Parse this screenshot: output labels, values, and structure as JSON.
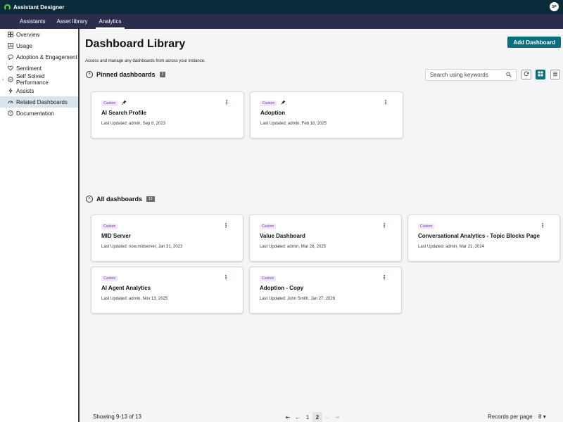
{
  "app": {
    "title": "Assistant Designer",
    "avatar_initials": "SP"
  },
  "tabs": [
    {
      "label": "Assistants"
    },
    {
      "label": "Asset library"
    },
    {
      "label": "Analytics",
      "active": true
    }
  ],
  "sidebar": {
    "items": [
      {
        "label": "Overview",
        "icon": "grid-icon"
      },
      {
        "label": "Usage",
        "icon": "chart-icon"
      },
      {
        "label": "Adoption & Engagement",
        "icon": "chat-icon"
      },
      {
        "label": "Sentiment",
        "icon": "heart-icon"
      },
      {
        "label": "Self Solved Performance",
        "icon": "chevron-right-icon"
      },
      {
        "label": "Assists",
        "icon": "bolt-icon"
      },
      {
        "label": "Related Dashboards",
        "icon": "dashboard-icon",
        "active": true
      },
      {
        "label": "Documentation",
        "icon": "help-icon"
      }
    ]
  },
  "main": {
    "title": "Dashboard Library",
    "add_button": "Add Dashboard",
    "subtitle": "Access and manage any dashboards from across your instance.",
    "search_placeholder": "Search using keywords",
    "pinned": {
      "heading": "Pinned dashboards",
      "count": "2",
      "cards": [
        {
          "badge": "Custom",
          "title": "AI Search Profile",
          "meta": "Last Updated: admin, Sep 8, 2023"
        },
        {
          "badge": "Custom",
          "title": "Adoption",
          "meta": "Last Updated: admin, Feb 18, 2025"
        }
      ]
    },
    "all": {
      "heading": "All dashboards",
      "count": "13",
      "cards": [
        {
          "badge": "Custom",
          "title": "MID Server",
          "meta": "Last Updated: now.midserver, Jan 31, 2023"
        },
        {
          "badge": "Custom",
          "title": "Value Dashboard",
          "meta": "Last Updated: admin, Mar 28, 2025"
        },
        {
          "badge": "Custom",
          "title": "Conversational Analytics - Topic Blocks Page",
          "meta": "Last Updated: admin, Mar 21, 2024"
        },
        {
          "badge": "Custom",
          "title": "AI Agent Analytics",
          "meta": "Last Updated: admin, Nov 13, 2025"
        },
        {
          "badge": "Custom",
          "title": "Adoption - Copy",
          "meta": "Last Updated: John Smith, Jan 27, 2026"
        }
      ]
    }
  },
  "footer": {
    "showing": "Showing 9-13 of 13",
    "pages": [
      "1",
      "2"
    ],
    "current_page": "2",
    "records_label": "Records per page",
    "records_value": "8"
  }
}
